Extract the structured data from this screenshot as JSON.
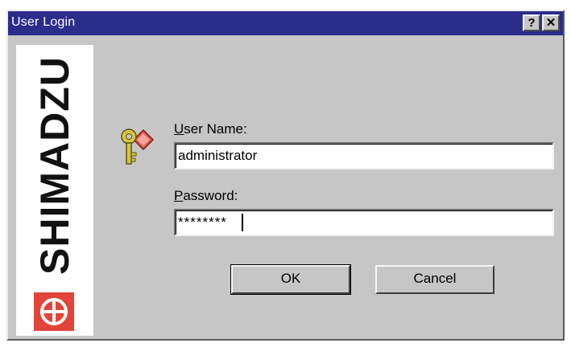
{
  "window": {
    "title": "User Login",
    "help_glyph": "?",
    "close_glyph": "✕"
  },
  "logo": {
    "brand": "SHIMADZU",
    "mark_icon": "shimadzu-cross-circle-icon",
    "brand_color": "#e2443a"
  },
  "form": {
    "icon": "key-icon",
    "username": {
      "label_prefix": "",
      "label_mnemonic": "U",
      "label_rest": "ser Name:",
      "value": "administrator"
    },
    "password": {
      "label_mnemonic": "P",
      "label_rest": "assword:",
      "value": "********"
    }
  },
  "buttons": {
    "ok": "OK",
    "cancel": "Cancel"
  },
  "colors": {
    "titlebar": "#2b2d8a",
    "dialog_bg": "#c6c6c6"
  }
}
